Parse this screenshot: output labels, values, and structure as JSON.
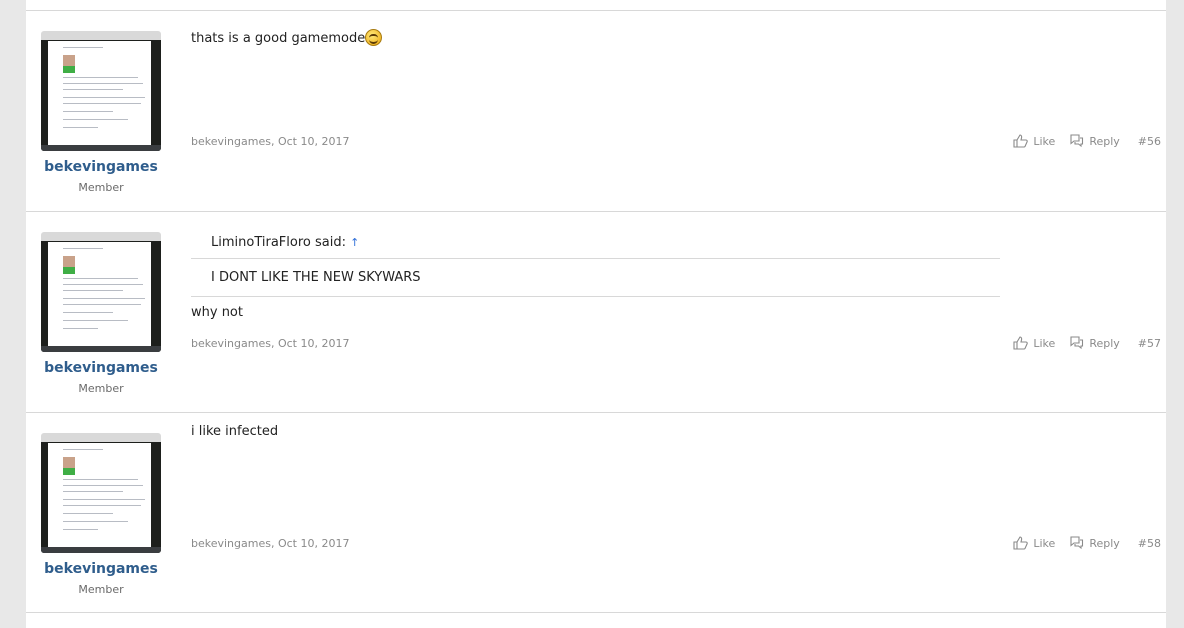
{
  "posts": [
    {
      "username": "bekevingames",
      "role": "Member",
      "message": "thats is a good gamemode",
      "smiley_icon": "smile-icon",
      "meta": "bekevingames, Oct 10, 2017",
      "like_label": "Like",
      "reply_label": "Reply",
      "number": "#56"
    },
    {
      "username": "bekevingames",
      "role": "Member",
      "quote": {
        "author_said": "LiminoTiraFloro said:",
        "arrow": "↑",
        "text": "I DONT LIKE THE NEW SKYWARS"
      },
      "message": "why not",
      "meta": "bekevingames, Oct 10, 2017",
      "like_label": "Like",
      "reply_label": "Reply",
      "number": "#57"
    },
    {
      "username": "bekevingames",
      "role": "Member",
      "message": "i like infected",
      "meta": "bekevingames, Oct 10, 2017",
      "like_label": "Like",
      "reply_label": "Reply",
      "number": "#58"
    }
  ],
  "colors": {
    "username": "#2f5d8c",
    "meta": "#8a8a8a",
    "page_bg": "#e8e8e8"
  }
}
